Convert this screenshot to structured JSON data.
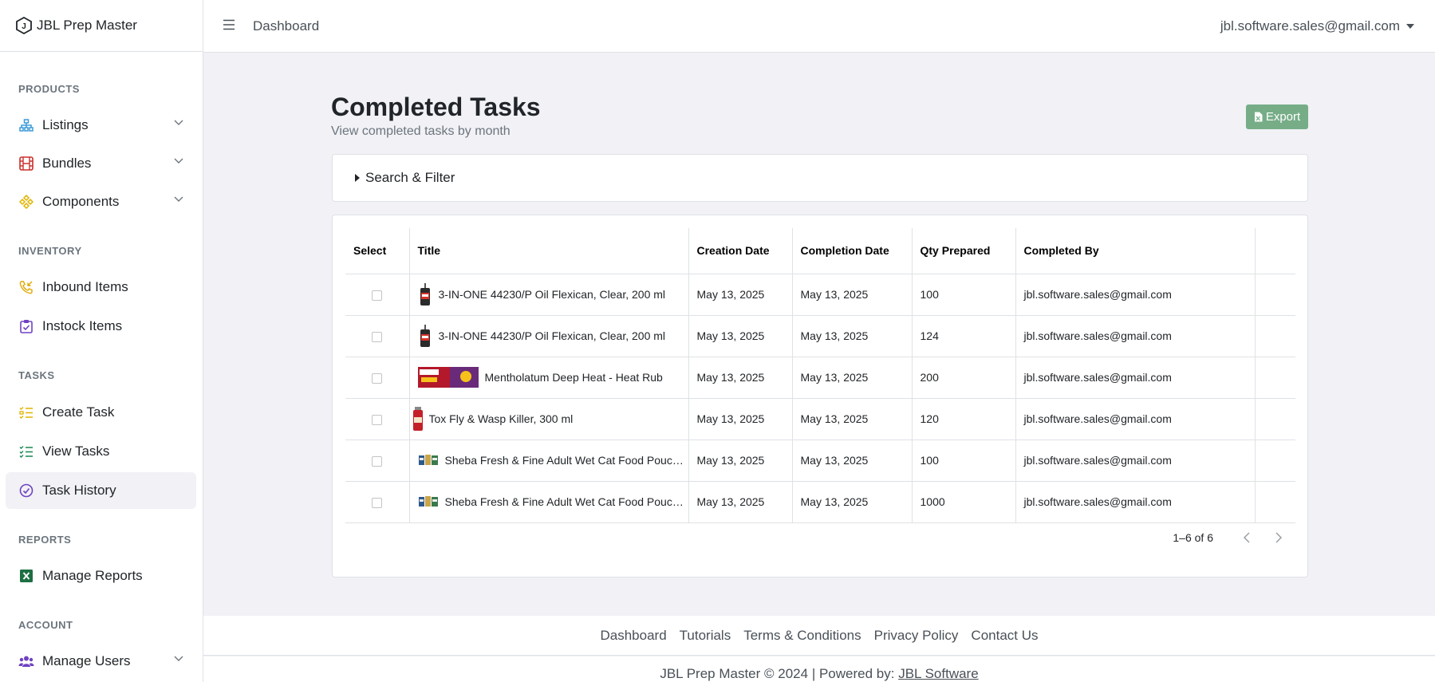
{
  "brand": {
    "name": "JBL Prep Master"
  },
  "header": {
    "breadcrumb": "Dashboard",
    "user_email": "jbl.software.sales@gmail.com"
  },
  "sidebar": {
    "sections": [
      {
        "title": "PRODUCTS"
      },
      {
        "title": "INVENTORY"
      },
      {
        "title": "TASKS"
      },
      {
        "title": "REPORTS"
      },
      {
        "title": "ACCOUNT"
      }
    ],
    "items": [
      {
        "label": "Listings",
        "icon": "sitemap-icon",
        "color": "#3b9ad9"
      },
      {
        "label": "Bundles",
        "icon": "film-icon",
        "color": "#c9302c"
      },
      {
        "label": "Components",
        "icon": "components-icon",
        "color": "#e0b400"
      },
      {
        "label": "Inbound Items",
        "icon": "phone-incoming-icon",
        "color": "#e0a800"
      },
      {
        "label": "Instock Items",
        "icon": "clipboard-check-icon",
        "color": "#6f42c1"
      },
      {
        "label": "Create Task",
        "icon": "list-check-icon",
        "color": "#e0b400"
      },
      {
        "label": "View Tasks",
        "icon": "list-check-icon",
        "color": "#198754"
      },
      {
        "label": "Task History",
        "icon": "circle-check-icon",
        "color": "#6f42c1"
      },
      {
        "label": "Manage Reports",
        "icon": "excel-icon",
        "color": "#1d6f42"
      },
      {
        "label": "Manage Users",
        "icon": "users-icon",
        "color": "#6f42c1"
      }
    ]
  },
  "main": {
    "title": "Completed Tasks",
    "subtitle": "View completed tasks by month",
    "export_label": "Export",
    "filter_label": "Search & Filter"
  },
  "table": {
    "columns": [
      "Select",
      "Title",
      "Creation Date",
      "Completion Date",
      "Qty Prepared",
      "Completed By"
    ],
    "rows": [
      {
        "title": "3-IN-ONE 44230/P Oil Flexican, Clear, 200 ml",
        "thumb": "oil-can",
        "created": "May 13, 2025",
        "completed": "May 13, 2025",
        "qty": "100",
        "by": "jbl.software.sales@gmail.com"
      },
      {
        "title": "3-IN-ONE 44230/P Oil Flexican, Clear, 200 ml",
        "thumb": "oil-can",
        "created": "May 13, 2025",
        "completed": "May 13, 2025",
        "qty": "124",
        "by": "jbl.software.sales@gmail.com"
      },
      {
        "title": "Mentholatum Deep Heat - Heat Rub",
        "thumb": "deep-heat",
        "created": "May 13, 2025",
        "completed": "May 13, 2025",
        "qty": "200",
        "by": "jbl.software.sales@gmail.com"
      },
      {
        "title": "Tox Fly & Wasp Killer, 300 ml",
        "thumb": "spray-can",
        "created": "May 13, 2025",
        "completed": "May 13, 2025",
        "qty": "120",
        "by": "jbl.software.sales@gmail.com"
      },
      {
        "title": "Sheba Fresh & Fine Adult Wet Cat Food Pouches",
        "thumb": "cat-food",
        "created": "May 13, 2025",
        "completed": "May 13, 2025",
        "qty": "100",
        "by": "jbl.software.sales@gmail.com"
      },
      {
        "title": "Sheba Fresh & Fine Adult Wet Cat Food Pouches",
        "thumb": "cat-food",
        "created": "May 13, 2025",
        "completed": "May 13, 2025",
        "qty": "1000",
        "by": "jbl.software.sales@gmail.com"
      }
    ],
    "pagination": "1–6 of 6"
  },
  "footer": {
    "links": [
      "Dashboard",
      "Tutorials",
      "Terms & Conditions",
      "Privacy Policy",
      "Contact Us"
    ],
    "copyright": "JBL Prep Master © 2024 | Powered by: ",
    "powered_link": "JBL Software"
  }
}
